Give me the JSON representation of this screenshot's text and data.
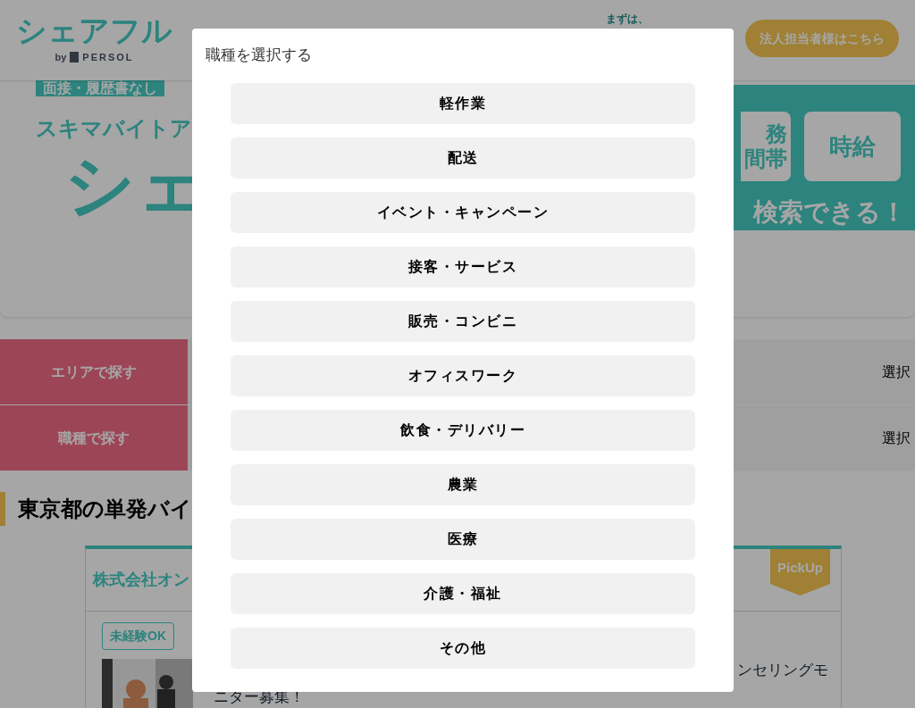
{
  "header": {
    "logo": "シェアフル",
    "logo_by": "by",
    "logo_brand": "PERSOL",
    "intro_label": "まずは、",
    "corporate_button": "法人担当者様はこちら"
  },
  "banner": {
    "strip": "面接・履歴書なし",
    "subtitle": "スキマバイトア",
    "title": "シェ",
    "tile_cut_line1": "務",
    "tile_cut_line2": "間帯",
    "tile": "時給",
    "tagline": "検索できる！"
  },
  "search_rows": [
    {
      "label": "エリアで探す",
      "action": "選択"
    },
    {
      "label": "職種で探す",
      "action": "選択"
    }
  ],
  "section_heading": "東京都の単発バイ",
  "job_card": {
    "company": "株式会社オン",
    "badge": "PickUp",
    "tags": [
      "未経験OK"
    ],
    "description_line1": "ンセリングモ",
    "description_line2": "ニター募集！"
  },
  "modal": {
    "title": "職種を選択する",
    "options": [
      "軽作業",
      "配送",
      "イベント・キャンペーン",
      "接客・サービス",
      "販売・コンビニ",
      "オフィスワーク",
      "飲食・デリバリー",
      "農業",
      "医療",
      "介護・福祉",
      "その他"
    ]
  }
}
